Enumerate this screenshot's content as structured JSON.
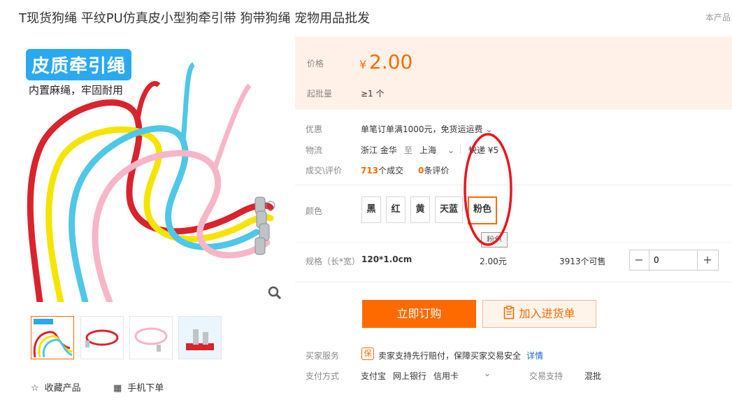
{
  "product": {
    "title": "T现货狗绳 平纹PU仿真皮小型狗牵引带 狗带狗绳 宠物用品批发",
    "corner_tag": "本产品"
  },
  "gallery": {
    "banner_text": "皮质牵引绳",
    "sub_text": "内置麻绳，牢固耐用",
    "rope_colors": [
      "#d9232d",
      "#f5e400",
      "#4fc7e8",
      "#f7b6c8"
    ]
  },
  "actions": {
    "favorite_label": "收藏产品",
    "mobile_order_label": "手机下单"
  },
  "price": {
    "label": "价格",
    "currency": "¥",
    "value": "2.00",
    "moq_label": "起批量",
    "moq_value": "≥1 个"
  },
  "info": {
    "promo_label": "优惠",
    "promo_text": "单笔订单满1000元，免货运运费",
    "logistics_label": "物流",
    "from": "浙江 金华",
    "to_word": "至",
    "to": "上海",
    "shipping": "快递 ¥5",
    "deals_label": "成交\\评价",
    "deals_count": "713",
    "deals_unit": "个成交",
    "reviews_count": "0",
    "reviews_unit": "条评价"
  },
  "colors": {
    "label": "颜色",
    "options": [
      "黑",
      "红",
      "黄",
      "天蓝",
      "粉色"
    ],
    "selected": "粉色",
    "tooltip": "粉色"
  },
  "spec": {
    "label": "规格（长*宽）",
    "value": "120*1.0cm",
    "price": "2.00元",
    "stock": "3913个可售",
    "quantity": "0",
    "minus": "−",
    "plus": "+"
  },
  "buttons": {
    "buy": "立即订购",
    "cart": "加入进货单"
  },
  "service": {
    "buyer_label": "买家服务",
    "guarantee_icon": "保",
    "guarantee_text": "卖家支持先行赔付，保障买家交易安全",
    "details_link": "详情",
    "pay_label": "支付方式",
    "pay_methods": [
      "支付宝",
      "网上银行",
      "信用卡"
    ],
    "trade_label": "交易支持",
    "trade_value": "混批"
  },
  "accent": {
    "orange": "#ff6a00",
    "annotation_red": "#e8161f"
  }
}
